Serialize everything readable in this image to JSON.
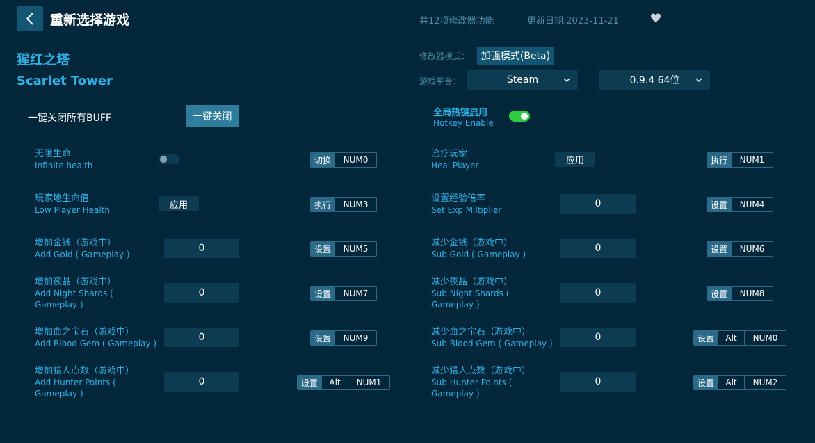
{
  "header": {
    "title": "重新选择游戏",
    "feature_count": "共12项修改器功能",
    "update_date": "更新日期:2023-11-21"
  },
  "game": {
    "name_cn": "猩红之塔",
    "name_en": "Scarlet Tower"
  },
  "mode": {
    "label": "修改器模式：",
    "value": "加强模式(Beta)"
  },
  "platform": {
    "label": "游戏平台：",
    "value": "Steam",
    "version": "0.9.4 64位"
  },
  "oneclick": {
    "label": "一键关闭所有BUFF",
    "button": "一键关闭"
  },
  "hotkey_enable": {
    "label_cn": "全局热键启用",
    "label_en": "Hotkey Enable",
    "on": true
  },
  "features": [
    {
      "cn": "无限生命",
      "en": "Infinite health",
      "control": "toggle",
      "action": "切换",
      "keys": [
        "NUM0"
      ]
    },
    {
      "cn": "治疗玩家",
      "en": "Heal Player",
      "control": "apply",
      "control_label": "应用",
      "action": "执行",
      "keys": [
        "NUM1"
      ]
    },
    {
      "cn": "玩家地生命值",
      "en": "Low Player Health",
      "control": "apply",
      "control_label": "应用",
      "action": "执行",
      "keys": [
        "NUM3"
      ]
    },
    {
      "cn": "设置经验倍率",
      "en": "Set Exp Miltiplier",
      "control": "input",
      "value": "0",
      "action": "设置",
      "keys": [
        "NUM4"
      ]
    },
    {
      "cn": "增加金钱（游戏中）",
      "en": "Add Gold ( Gameplay )",
      "control": "input",
      "value": "0",
      "action": "设置",
      "keys": [
        "NUM5"
      ]
    },
    {
      "cn": "减少金钱（游戏中）",
      "en": "Sub Gold ( Gameplay )",
      "control": "input",
      "value": "0",
      "action": "设置",
      "keys": [
        "NUM6"
      ]
    },
    {
      "cn": "增加夜晶（游戏中）",
      "en": "Add Night Shards ( Gameplay )",
      "control": "input",
      "value": "0",
      "action": "设置",
      "keys": [
        "NUM7"
      ]
    },
    {
      "cn": "减少夜晶（游戏中）",
      "en": "Sub Night Shards ( Gameplay )",
      "control": "input",
      "value": "0",
      "action": "设置",
      "keys": [
        "NUM8"
      ]
    },
    {
      "cn": "增加血之宝石（游戏中）",
      "en": "Add Blood Gem ( Gameplay )",
      "control": "input",
      "value": "0",
      "action": "设置",
      "keys": [
        "NUM9"
      ]
    },
    {
      "cn": "减少血之宝石（游戏中）",
      "en": "Sub Blood Gem ( Gameplay )",
      "control": "input",
      "value": "0",
      "action": "设置",
      "keys": [
        "Alt",
        "NUM0"
      ]
    },
    {
      "cn": "增加猎人点数（游戏中）",
      "en": "Add Hunter Points ( Gameplay )",
      "control": "input",
      "value": "0",
      "action": "设置",
      "keys": [
        "Alt",
        "NUM1"
      ]
    },
    {
      "cn": "减少猎人点数（游戏中）",
      "en": "Sub Hunter Points ( Gameplay )",
      "control": "input",
      "value": "0",
      "action": "设置",
      "keys": [
        "Alt",
        "NUM2"
      ]
    }
  ]
}
